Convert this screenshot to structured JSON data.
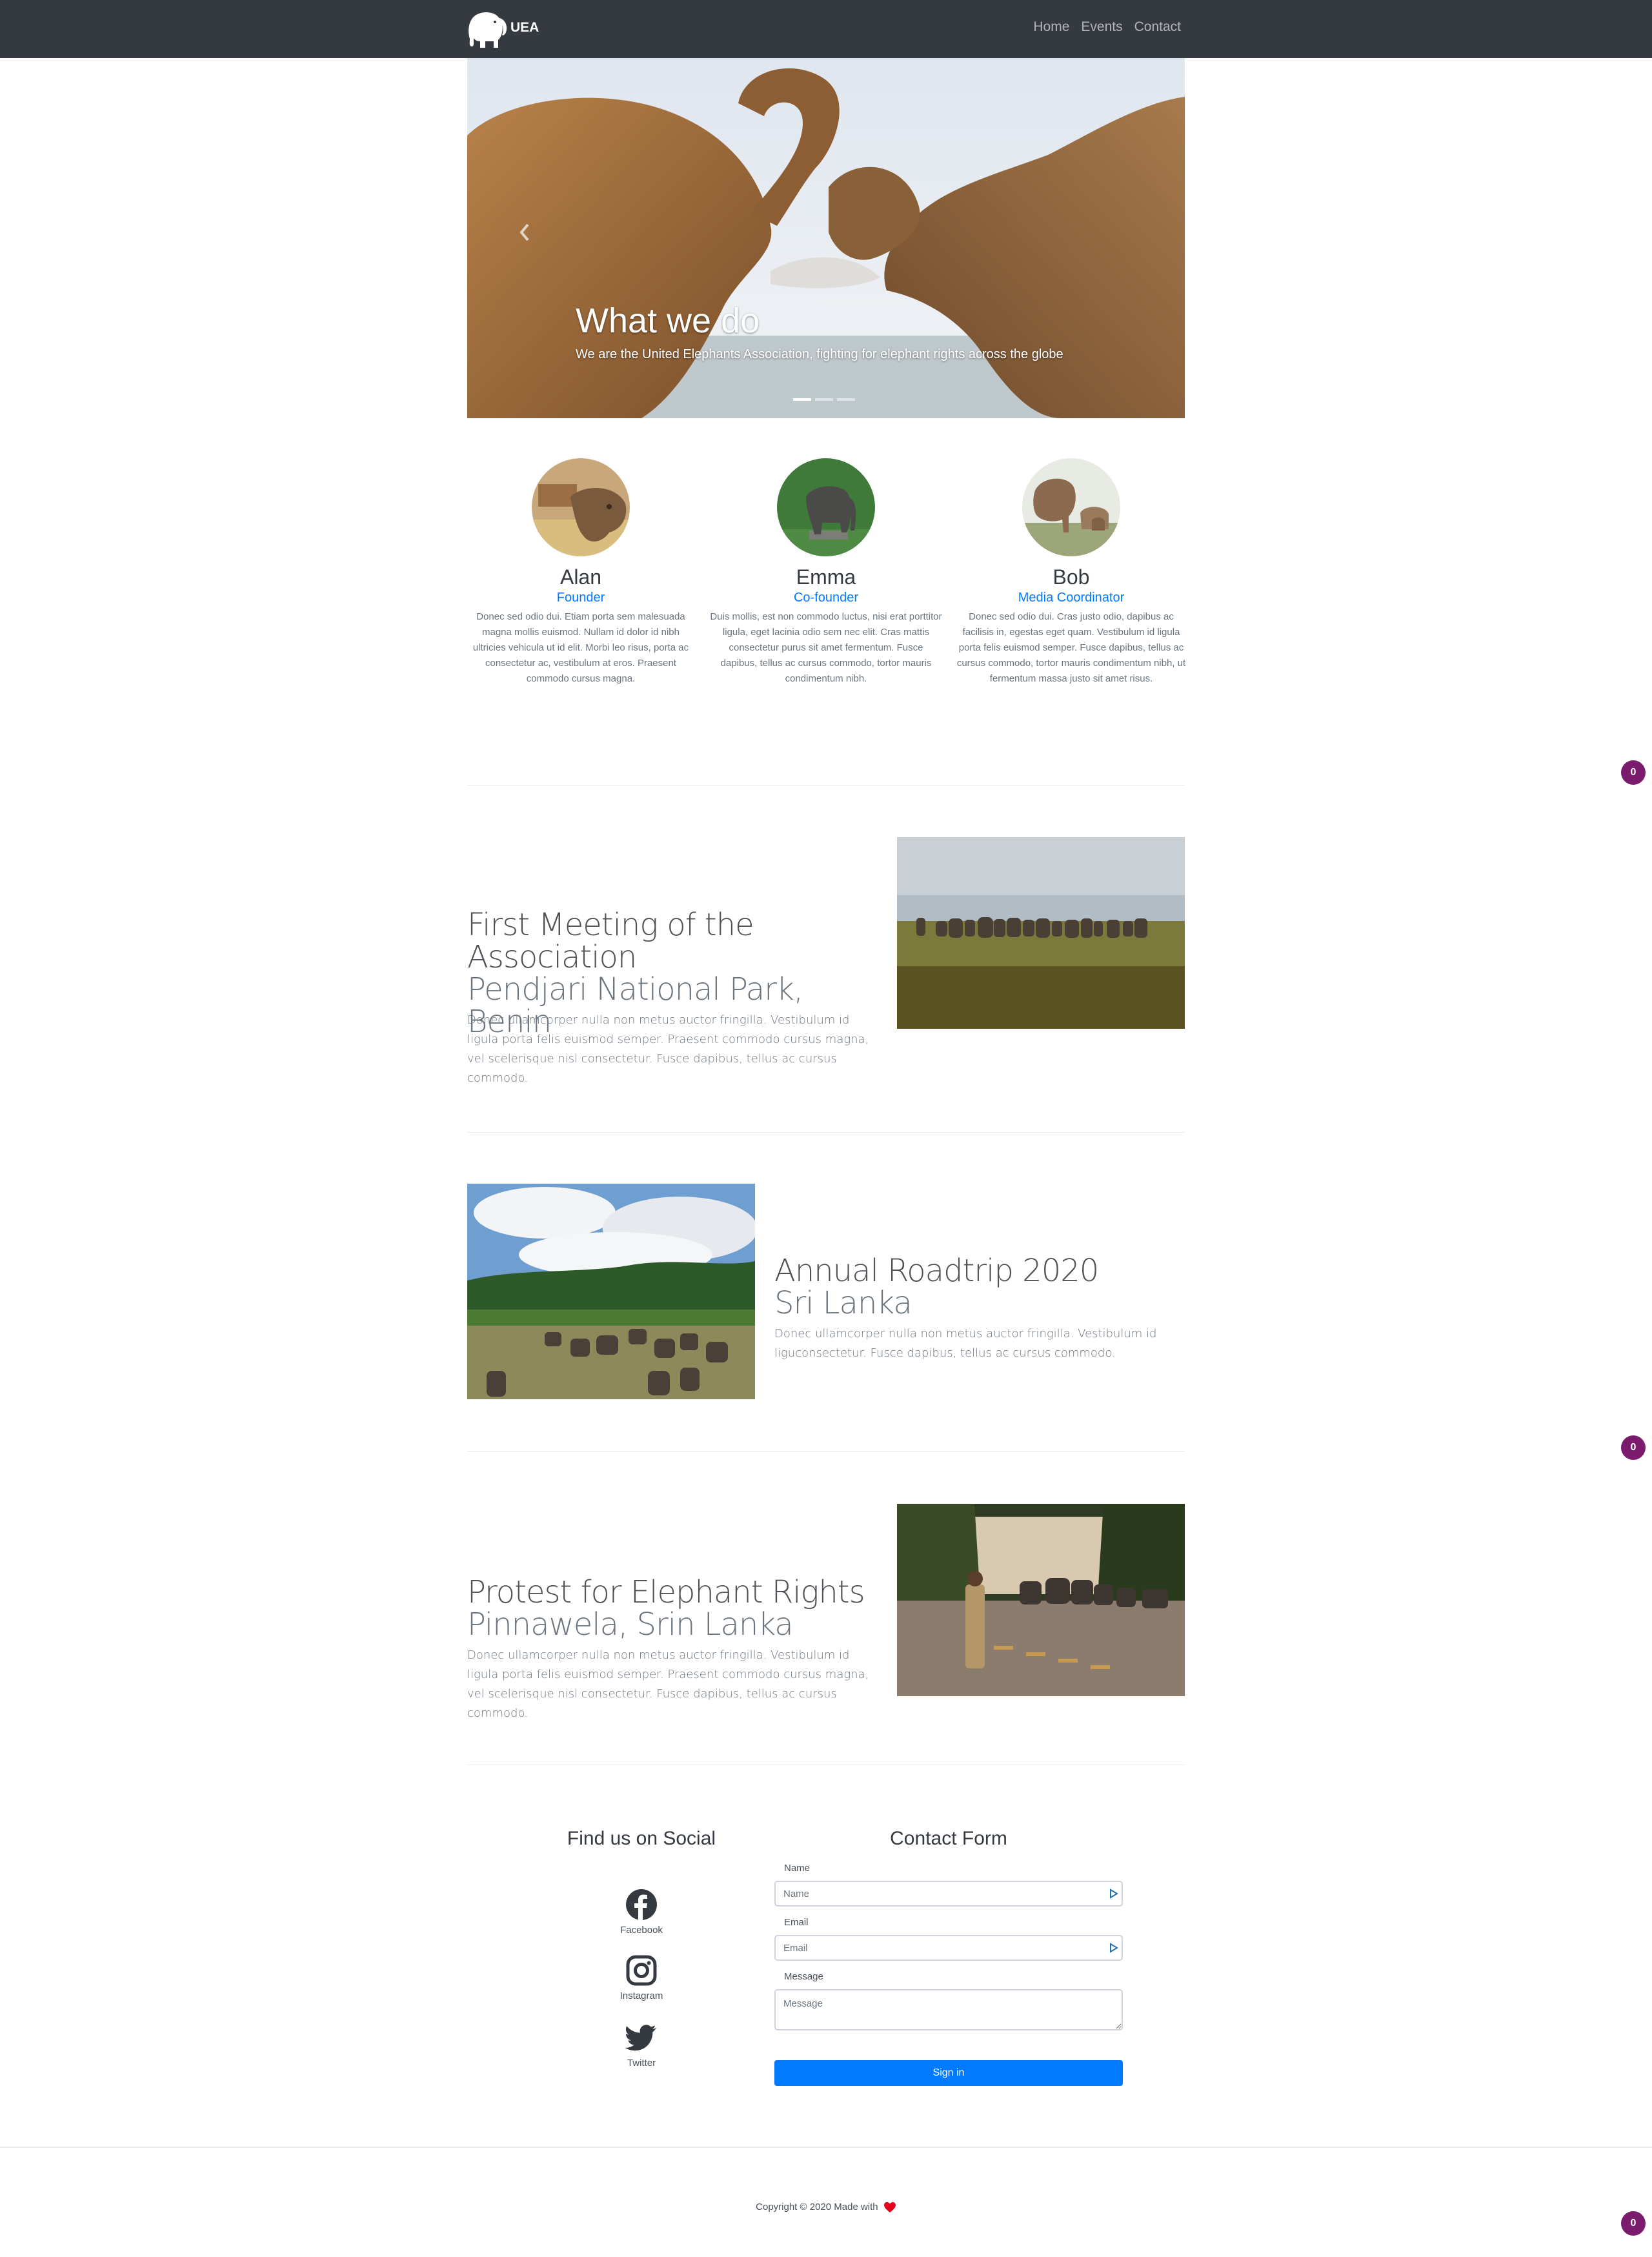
{
  "navbar": {
    "brand": "UEA",
    "links": [
      "Home",
      "Events",
      "Contact"
    ]
  },
  "hero": {
    "title": "What we do",
    "text": "We are the United Elephants Association, fighting for elephant rights across the globe",
    "slides": 3,
    "active_slide": 1
  },
  "team": [
    {
      "name": "Alan",
      "role": "Founder",
      "bio": "Donec sed odio dui. Etiam porta sem malesuada magna mollis euismod. Nullam id dolor id nibh ultricies vehicula ut id elit. Morbi leo risus, porta ac consectetur ac, vestibulum at eros. Praesent commodo cursus magna."
    },
    {
      "name": "Emma",
      "role": "Co-founder",
      "bio": "Duis mollis, est non commodo luctus, nisi erat porttitor ligula, eget lacinia odio sem nec elit. Cras mattis consectetur purus sit amet fermentum. Fusce dapibus, tellus ac cursus commodo, tortor mauris condimentum nibh."
    },
    {
      "name": "Bob",
      "role": "Media Coordinator",
      "bio": "Donec sed odio dui. Cras justo odio, dapibus ac facilisis in, egestas eget quam. Vestibulum id ligula porta felis euismod semper. Fusce dapibus, tellus ac cursus commodo, tortor mauris condimentum nibh, ut fermentum massa justo sit amet risus."
    }
  ],
  "events": [
    {
      "heading_1": "First Meeting of the",
      "heading_2": "Association",
      "subheading": "Pendjari National Park, Benin",
      "text": "Donec ullamcorper nulla non metus auctor fringilla. Vestibulum id ligula porta felis euismod semper. Praesent commodo cursus magna, vel scelerisque nisl consectetur. Fusce dapibus, tellus ac cursus commodo."
    },
    {
      "heading_1": "Annual Roadtrip 2020",
      "subheading": "Sri Lanka",
      "text": "Donec ullamcorper nulla non metus auctor fringilla. Vestibulum id liguconsectetur. Fusce dapibus, tellus ac cursus commodo."
    },
    {
      "heading_1": "Protest for Elephant Rights",
      "subheading": "Pinnawela, Srin Lanka",
      "text": "Donec ullamcorper nulla non metus auctor fringilla. Vestibulum id ligula porta felis euismod semper. Praesent commodo cursus magna, vel scelerisque nisl consectetur. Fusce dapibus, tellus ac cursus commodo."
    }
  ],
  "social": {
    "title": "Find us on Social",
    "items": [
      {
        "label": "Facebook",
        "icon": "facebook-icon"
      },
      {
        "label": "Instagram",
        "icon": "instagram-icon"
      },
      {
        "label": "Twitter",
        "icon": "twitter-icon"
      }
    ]
  },
  "contact_form": {
    "title": "Contact Form",
    "name_label": "Name",
    "name_placeholder": "Name",
    "email_label": "Email",
    "email_placeholder": "Email",
    "message_label": "Message",
    "message_placeholder": "Message",
    "submit_label": "Sign in"
  },
  "footer": {
    "copyright": "Copyright © 2020 Made with"
  },
  "badges": [
    "0",
    "0",
    "0"
  ],
  "colors": {
    "navbar": "#343a40",
    "accent": "#007bff",
    "badge": "#7a1b6d"
  }
}
